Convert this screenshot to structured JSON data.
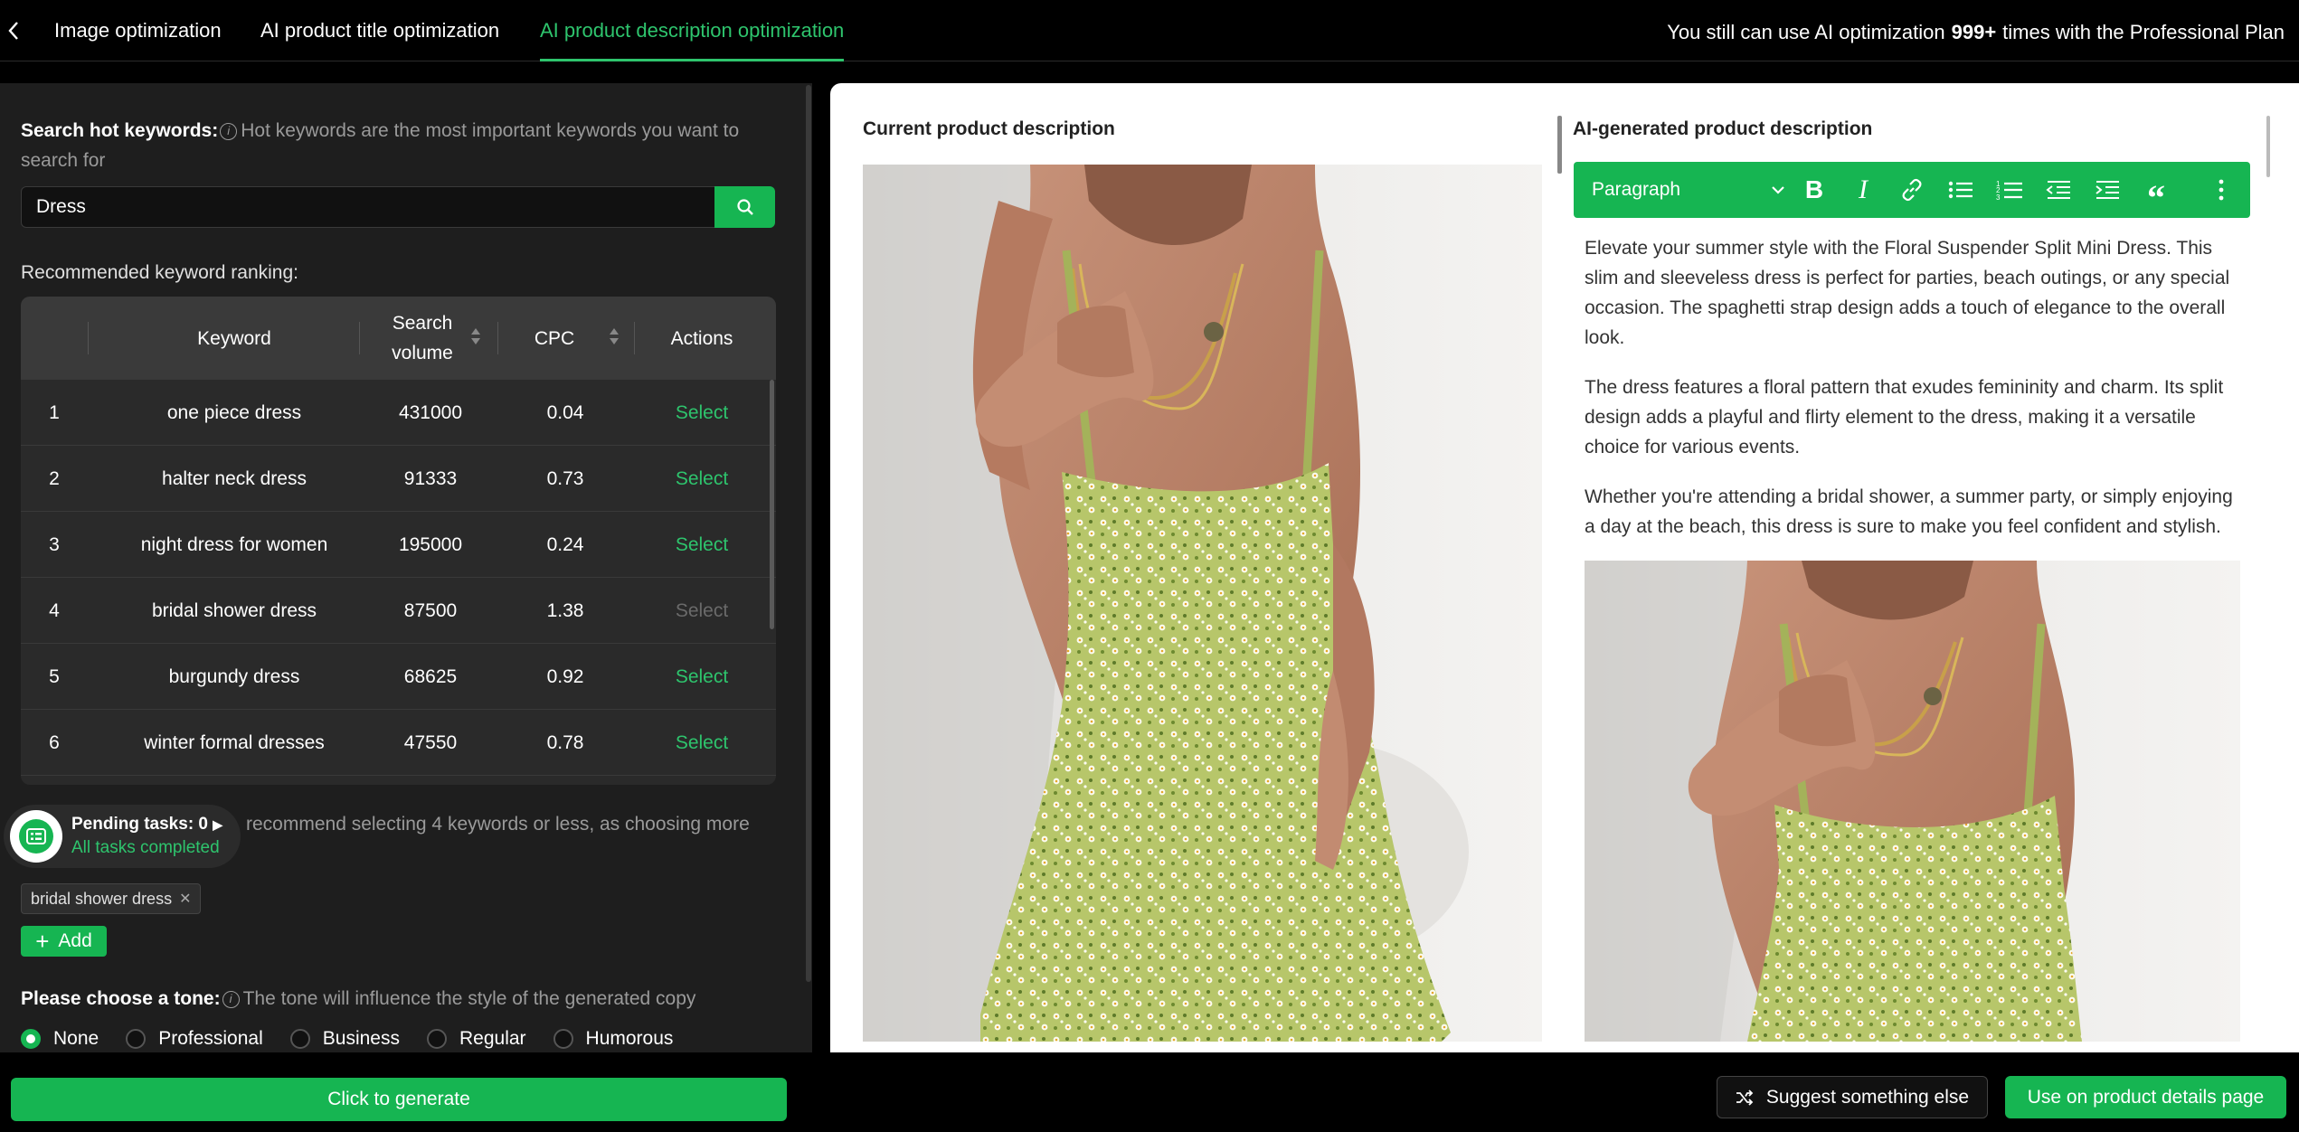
{
  "topnav": {
    "tabs": [
      {
        "label": "Image optimization",
        "active": false
      },
      {
        "label": "AI product title optimization",
        "active": false
      },
      {
        "label": "AI product description optimization",
        "active": true
      }
    ],
    "plan_prefix": "You still can use AI optimization",
    "plan_count": "999+",
    "plan_suffix": "times with the Professional Plan"
  },
  "search": {
    "label": "Search hot keywords:",
    "hint": "Hot keywords are the most important keywords you want to search for",
    "value": "Dress"
  },
  "ranking": {
    "label": "Recommended keyword ranking:",
    "columns": [
      "Keyword",
      "Search volume",
      "CPC",
      "Actions"
    ],
    "rows": [
      {
        "rank": "1",
        "keyword": "one piece dress",
        "volume": "431000",
        "cpc": "0.04",
        "action": "Select",
        "disabled": false
      },
      {
        "rank": "2",
        "keyword": "halter neck dress",
        "volume": "91333",
        "cpc": "0.73",
        "action": "Select",
        "disabled": false
      },
      {
        "rank": "3",
        "keyword": "night dress for women",
        "volume": "195000",
        "cpc": "0.24",
        "action": "Select",
        "disabled": false
      },
      {
        "rank": "4",
        "keyword": "bridal shower dress",
        "volume": "87500",
        "cpc": "1.38",
        "action": "Select",
        "disabled": true
      },
      {
        "rank": "5",
        "keyword": "burgundy dress",
        "volume": "68625",
        "cpc": "0.92",
        "action": "Select",
        "disabled": false
      },
      {
        "rank": "6",
        "keyword": "winter formal dresses",
        "volume": "47550",
        "cpc": "0.78",
        "action": "Select",
        "disabled": false
      }
    ]
  },
  "pending": {
    "title": "Pending tasks: 0",
    "status": "All tasks completed"
  },
  "selection_hint": "recommend selecting 4 keywords or less, as choosing more",
  "selected_keywords": [
    "bridal shower dress"
  ],
  "add_label": "Add",
  "tone": {
    "label": "Please choose a tone:",
    "hint": "The tone will influence the style of the generated copy",
    "options": [
      "None",
      "Professional",
      "Business",
      "Regular",
      "Humorous"
    ],
    "selected": "None"
  },
  "generate_label": "Click to generate",
  "current": {
    "title": "Current product description"
  },
  "ai": {
    "title": "AI-generated product description",
    "toolbar_paragraph": "Paragraph",
    "paragraphs": [
      "Elevate your summer style with the Floral Suspender Split Mini Dress. This slim and sleeveless dress is perfect for parties, beach outings, or any special occasion. The spaghetti strap design adds a touch of elegance to the overall look.",
      "The dress features a floral pattern that exudes femininity and charm. Its split design adds a playful and flirty element to the dress, making it a versatile choice for various events.",
      "Whether you're attending a bridal shower, a summer party, or simply enjoying a day at the beach, this dress is sure to make you feel confident and stylish."
    ]
  },
  "footer": {
    "suggest_label": "Suggest something else",
    "use_label": "Use on product details page"
  },
  "colors": {
    "accent": "#16b552",
    "accent_text": "#2ec46d",
    "panel_dark": "#1e1e1e"
  }
}
